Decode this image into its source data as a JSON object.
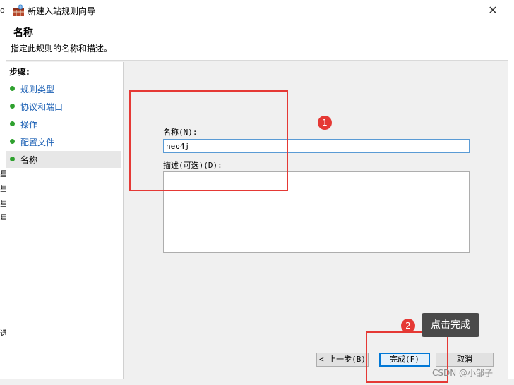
{
  "window": {
    "title": "新建入站规则向导",
    "close_glyph": "✕"
  },
  "header": {
    "title": "名称",
    "description": "指定此规则的名称和描述。"
  },
  "steps": {
    "title": "步骤:",
    "items": [
      {
        "label": "规则类型"
      },
      {
        "label": "协议和端口"
      },
      {
        "label": "操作"
      },
      {
        "label": "配置文件"
      },
      {
        "label": "名称"
      }
    ],
    "current_index": 4
  },
  "form": {
    "name_label": "名称(N):",
    "name_value": "neo4j",
    "description_label": "描述(可选)(D):",
    "description_value": ""
  },
  "buttons": {
    "back": "< 上一步(B)",
    "finish": "完成(F)",
    "cancel": "取消"
  },
  "annotations": {
    "badge1": "1",
    "badge2": "2",
    "tooltip": "点击完成",
    "color": "#e53935"
  },
  "background": {
    "left_chars": [
      "o",
      "星",
      "星",
      "星",
      "星",
      "选"
    ]
  },
  "watermark": "CSDN @小邹子",
  "icons": {
    "title_icon": "firewall-icon",
    "close_icon": "close-icon"
  }
}
